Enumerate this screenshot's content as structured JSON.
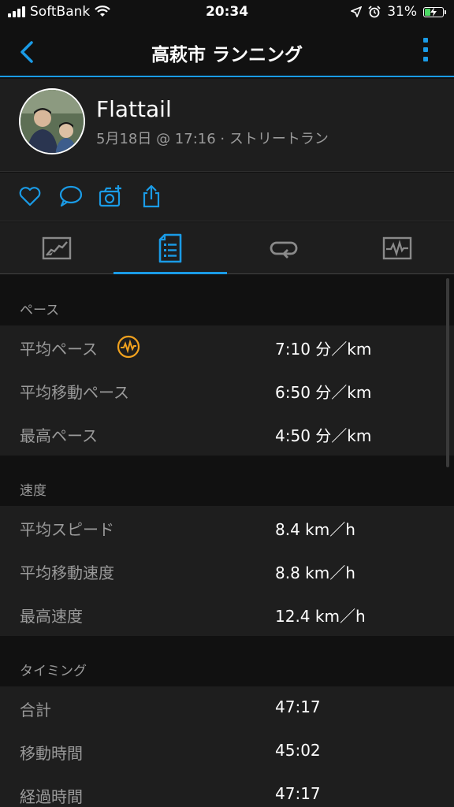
{
  "status_bar": {
    "carrier": "SoftBank",
    "time": "20:34",
    "battery_percent": "31%"
  },
  "header": {
    "title": "高萩市 ランニング"
  },
  "profile": {
    "name": "Flattail",
    "meta": "5月18日 @ 17:16 · ストリートラン"
  },
  "colors": {
    "accent": "#1a9be6",
    "pace_badge": "#f0a11e",
    "battery_fill": "#4cd964"
  },
  "actions": [
    {
      "icon": "heart-icon"
    },
    {
      "icon": "comment-icon"
    },
    {
      "icon": "add-photo-icon"
    },
    {
      "icon": "share-icon"
    }
  ],
  "tabs": [
    {
      "icon": "map-overview-icon",
      "selected": false
    },
    {
      "icon": "stats-list-icon",
      "selected": true
    },
    {
      "icon": "laps-icon",
      "selected": false
    },
    {
      "icon": "chart-icon",
      "selected": false
    }
  ],
  "sections": {
    "pace": {
      "title": "ペース",
      "rows": [
        {
          "label": "平均ペース",
          "value": "7:10 分／km"
        },
        {
          "label": "平均移動ペース",
          "value": "6:50 分／km"
        },
        {
          "label": "最高ペース",
          "value": "4:50 分／km"
        }
      ]
    },
    "speed": {
      "title": "速度",
      "rows": [
        {
          "label": "平均スピード",
          "value": "8.4 km／h"
        },
        {
          "label": "平均移動速度",
          "value": "8.8 km／h"
        },
        {
          "label": "最高速度",
          "value": "12.4 km／h"
        }
      ]
    },
    "timing": {
      "title": "タイミング",
      "rows": [
        {
          "label": "合計",
          "value": "47:17"
        },
        {
          "label": "移動時間",
          "value": "45:02"
        },
        {
          "label": "経過時間",
          "value": "47:17"
        }
      ]
    }
  }
}
